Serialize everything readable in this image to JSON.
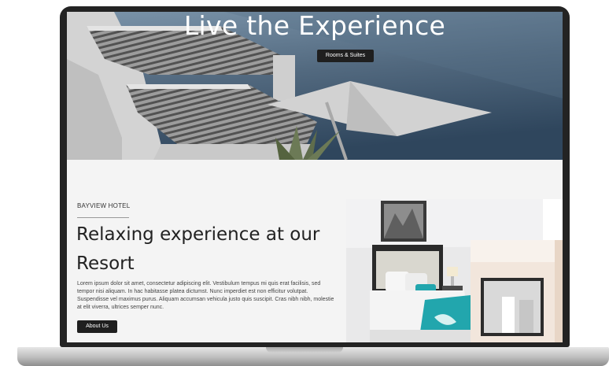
{
  "hero": {
    "title": "Live the Experience",
    "button_label": "Rooms & Suites"
  },
  "about": {
    "eyebrow": "BAYVIEW HOTEL",
    "headline": "Relaxing experience at our Resort",
    "body": "Lorem ipsum dolor sit amet, consectetur adipiscing elit. Vestibulum tempus mi quis erat facilisis, sed tempor nisi aliquam. In hac habitasse platea dictumst. Nunc imperdiet est non efficitur volutpat. Suspendisse vel maximus purus. Aliquam accumsan vehicula justo quis suscipit. Cras nibh nibh, molestie at elit viverra, ultrices semper nunc.",
    "button_label": "About Us"
  },
  "colors": {
    "button_bg": "#1f1f1f",
    "page_bg": "#f4f4f4",
    "bezel": "#232323",
    "accent_teal": "#22a6ad"
  }
}
